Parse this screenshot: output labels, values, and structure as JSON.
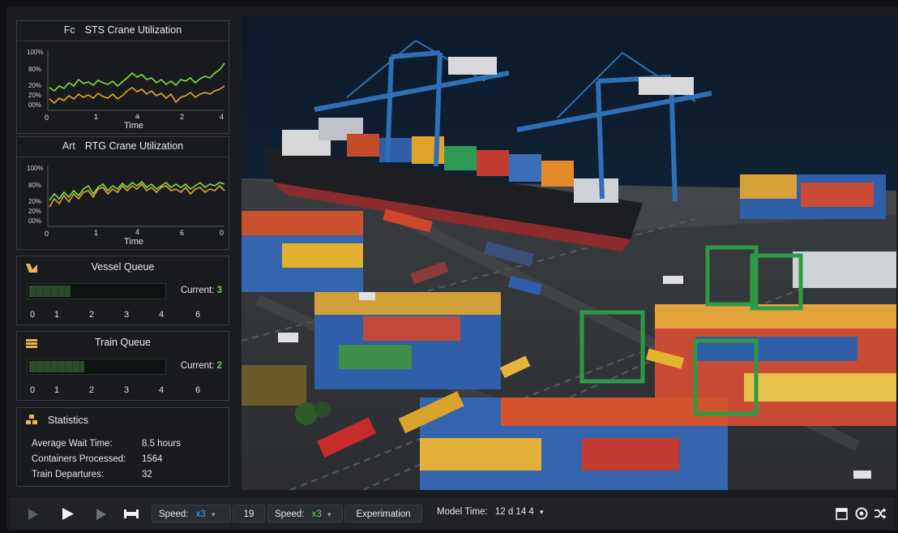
{
  "sts_panel": {
    "prefix": "Fc",
    "title": "STS Crane Utilization",
    "xlabel": "Time",
    "yticks": [
      "100%",
      "80%",
      "20%",
      "20%",
      "00%"
    ],
    "xticks": [
      "0",
      "1",
      "a",
      "2",
      "4"
    ]
  },
  "rtg_panel": {
    "prefix": "Art",
    "title": "RTG Crane Utilization",
    "xlabel": "Time",
    "yticks": [
      "100%",
      "80%",
      "20%",
      "20%",
      "00%"
    ],
    "xticks": [
      "0",
      "1",
      "4",
      "6",
      "0"
    ]
  },
  "vessel_queue": {
    "title": "Vessel Queue",
    "current_label": "Current:",
    "current_value": "3",
    "level": 0.3,
    "ticks": [
      "0",
      "1",
      "2",
      "3",
      "4",
      "6"
    ]
  },
  "train_queue": {
    "title": "Train Queue",
    "current_label": "Current:",
    "current_value": "2",
    "level": 0.4,
    "ticks": [
      "0",
      "1",
      "2",
      "3",
      "4",
      "6"
    ]
  },
  "statistics": {
    "title": "Statistics",
    "rows": [
      {
        "label": "Average Wait Time:",
        "value": "8.5 hours"
      },
      {
        "label": "Containers Processed:",
        "value": "1564"
      },
      {
        "label": "Train Departures:",
        "value": "32"
      }
    ]
  },
  "controls": {
    "speed1_label": "Speed:",
    "speed1_value": "x3",
    "step_value": "19",
    "speed2_label": "Speed:",
    "speed2_value": "x3",
    "experimation_label": "Experimation",
    "model_time_label": "Model Time:",
    "model_time_value": "12 d 14 4"
  },
  "colors": {
    "green": "#7ee046",
    "yellow": "#e8a72a",
    "crane_blue": "#2f6fb5",
    "rtg_green": "#2f9a45"
  },
  "icons": [
    "play-dim-icon",
    "play-icon",
    "step-icon",
    "fast-forward-icon",
    "window-icon",
    "settings-icon",
    "shuffle-icon"
  ]
}
